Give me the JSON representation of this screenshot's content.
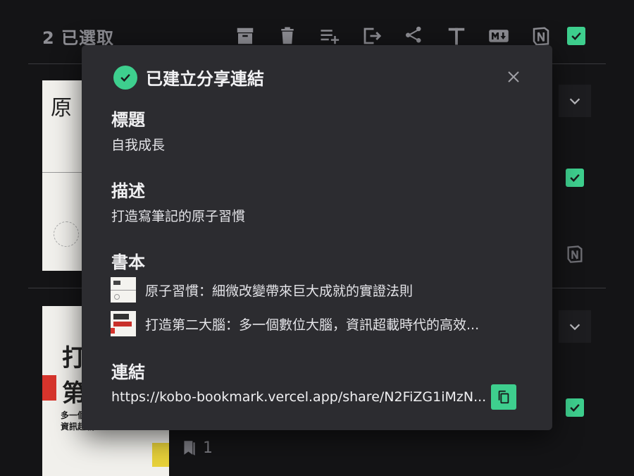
{
  "toolbar": {
    "selected_count": "2 已選取",
    "icons": [
      "archive-icon",
      "trash-icon",
      "playlist-add-icon",
      "export-icon",
      "share-icon",
      "text-icon",
      "markdown-icon",
      "notion-icon",
      "checkbox-icon"
    ]
  },
  "books_bg": [
    {
      "cover_title": "原",
      "bookmark_count": ""
    },
    {
      "cover_title": "打",
      "cover_title2": "第",
      "cover_caption": "多一個數",
      "cover_caption2": "資訊超載",
      "bookmark_count": "1"
    }
  ],
  "dialog": {
    "title": "已建立分享連結",
    "title_label": "標題",
    "title_value": "自我成長",
    "description_label": "描述",
    "description_value": "打造寫筆記的原子習慣",
    "books_label": "書本",
    "books": [
      {
        "title": "原子習慣：細微改變帶來巨大成就的實證法則"
      },
      {
        "title": "打造第二大腦：多一個數位大腦，資訊超載時代的高效..."
      }
    ],
    "link_label": "連結",
    "link_value": "https://kobo-bookmark.vercel.app/share/N2FiZG1iMzN..."
  },
  "colors": {
    "accent": "#3ecf8e",
    "dialog_bg": "#2c2c30",
    "page_bg": "#141416"
  }
}
